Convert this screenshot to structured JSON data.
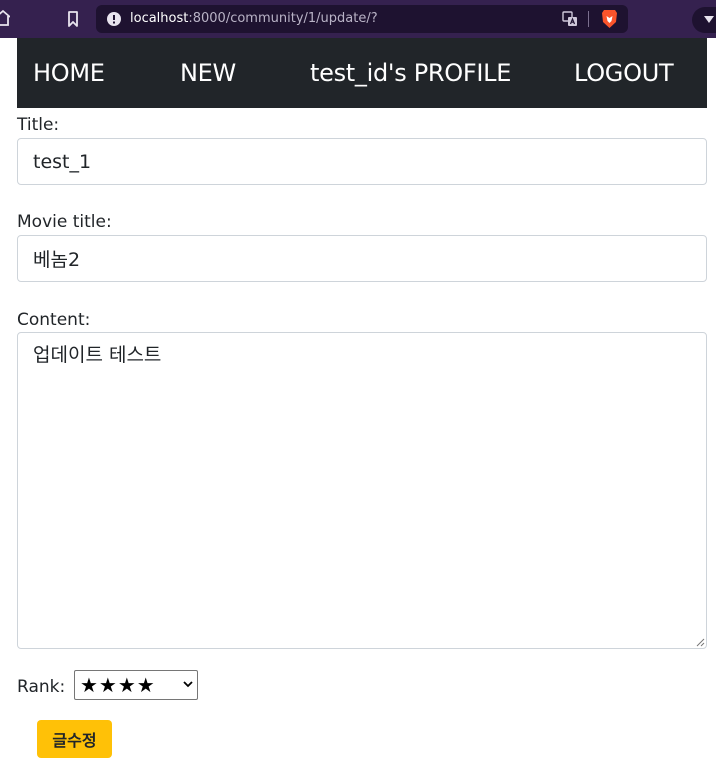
{
  "browser": {
    "url_host": "localhost",
    "url_path": ":8000/community/1/update/?"
  },
  "navbar": {
    "home_label": "HOME",
    "new_label": "NEW",
    "profile_label": "test_id's PROFILE",
    "logout_label": "LOGOUT"
  },
  "form": {
    "title_label": "Title:",
    "title_value": "test_1",
    "movie_title_label": "Movie title:",
    "movie_title_value": "베놈2",
    "content_label": "Content:",
    "content_value": "업데이트 테스트",
    "rank_label": "Rank:",
    "rank_value": "★★★★",
    "submit_label": "글수정"
  },
  "colors": {
    "browser_bar": "#35214f",
    "navbar_bg": "#212529",
    "button_bg": "#ffc107",
    "brave_accent": "#fb542b"
  },
  "icons": {
    "home": "home-icon",
    "bookmark": "bookmark-icon",
    "info": "info-icon",
    "translate": "translate-icon",
    "brave": "brave-lion-icon",
    "dropdown": "chevron-down-icon"
  }
}
